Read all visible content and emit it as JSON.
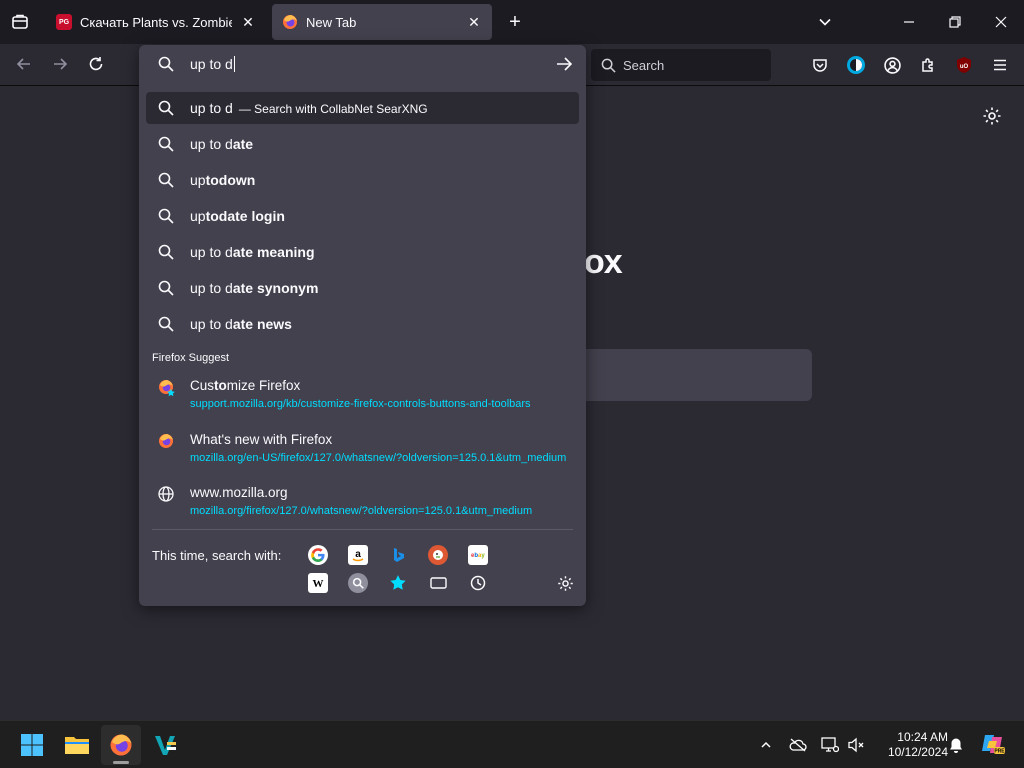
{
  "tabs": [
    {
      "title": "Скачать Plants vs. Zombies \"M",
      "favicon": "pg-logo",
      "active": false
    },
    {
      "title": "New Tab",
      "favicon": "firefox-logo",
      "active": true
    }
  ],
  "toolbar": {
    "search_placeholder": "Search"
  },
  "page": {
    "logo_text": "ox"
  },
  "urlbar": {
    "value": "up to d"
  },
  "results": {
    "heuristic": {
      "text": "up to d",
      "action": "— Search with CollabNet SearXNG"
    },
    "suggestions": [
      {
        "prefix": "up to d",
        "bold": "ate"
      },
      {
        "prefix": "up",
        "bold": "todown"
      },
      {
        "prefix": "up",
        "bold": "todate login"
      },
      {
        "prefix": "up to d",
        "bold": "ate meaning"
      },
      {
        "prefix": "up to d",
        "bold": "ate synonym"
      },
      {
        "prefix": "up to d",
        "bold": "ate news"
      }
    ],
    "group_label": "Firefox Suggest",
    "firefox_suggest": [
      {
        "title_pre": "Cus",
        "title_bold": "to",
        "title_post": "mize Firefox",
        "url": "support.mozilla.org/kb/customize-firefox-controls-buttons-and-toolbars",
        "icon": "firefox-star-icon"
      },
      {
        "title_pre": "What's new with Firefox",
        "title_bold": "",
        "title_post": "",
        "url": "mozilla.org/en-US/firefox/127.0/whatsnew/?oldversion=125.0.1&utm_medium",
        "icon": "firefox-icon"
      },
      {
        "title_pre": "www.mozilla.org",
        "title_bold": "",
        "title_post": "",
        "url": "mozilla.org/firefox/127.0/whatsnew/?oldversion=125.0.1&utm_medium",
        "icon": "globe-icon"
      }
    ]
  },
  "oneoff": {
    "label": "This time, search with:",
    "engines": [
      "google",
      "amazon",
      "bing",
      "duckduckgo",
      "ebay",
      "wikipedia",
      "searxng",
      "bookmarks",
      "tabs",
      "history"
    ]
  },
  "taskbar": {
    "time": "10:24 AM",
    "date": "10/12/2024"
  },
  "colors": {
    "accent": "#00ddff",
    "popup_bg": "#42414d",
    "toolbar_bg": "#2b2a33",
    "tabbar_bg": "#1c1b22"
  }
}
